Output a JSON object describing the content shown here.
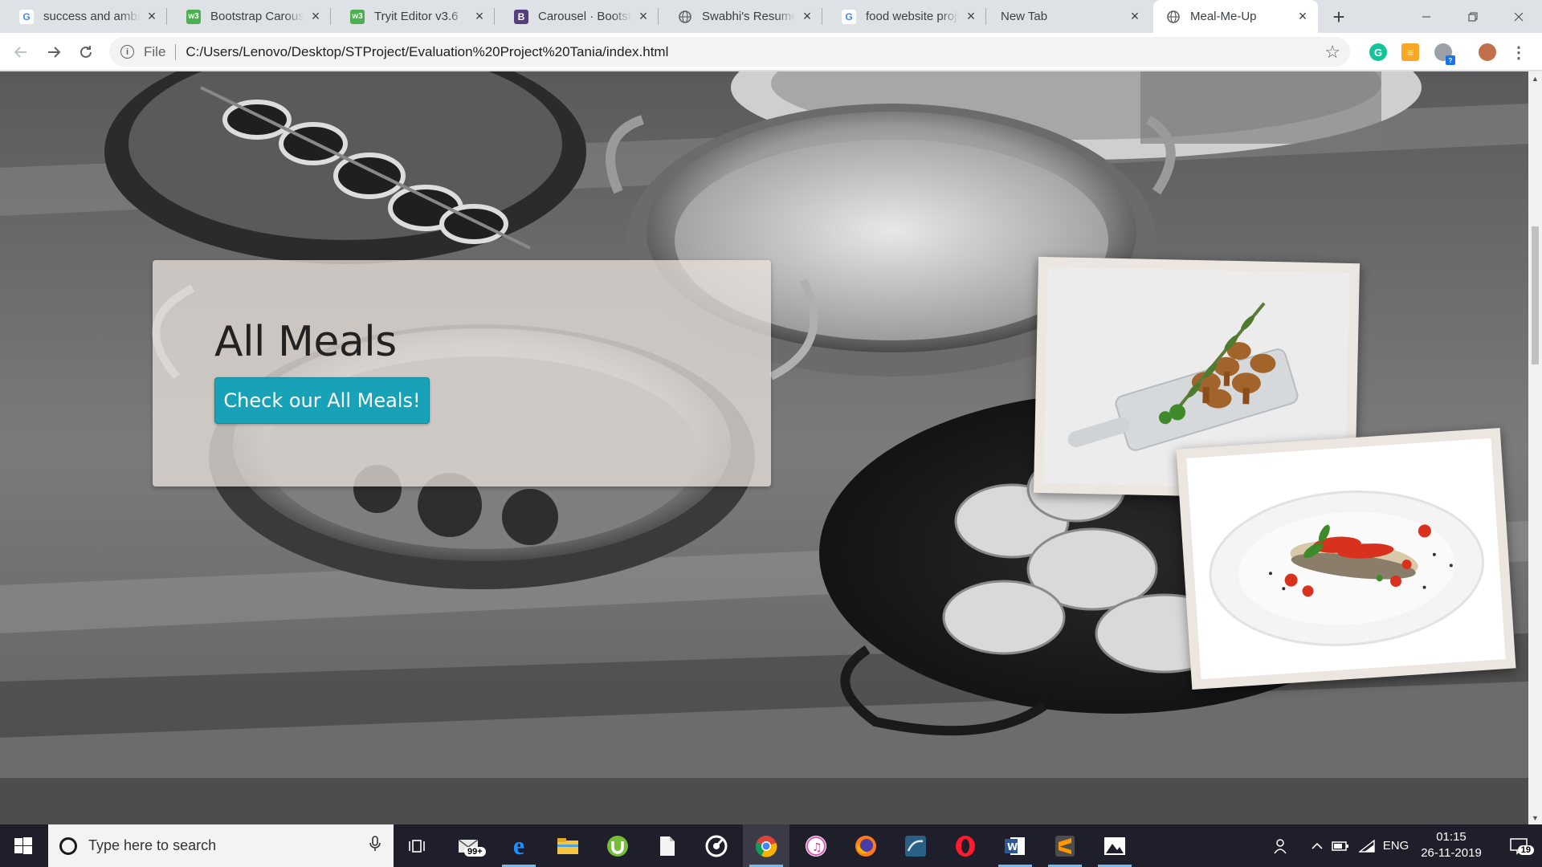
{
  "browser": {
    "tabs": [
      {
        "title": "success and ambiti",
        "favicon": "google-icon"
      },
      {
        "title": "Bootstrap Carousel",
        "favicon": "w3schools-icon"
      },
      {
        "title": "Tryit Editor v3.6",
        "favicon": "w3schools-icon"
      },
      {
        "title": "Carousel · Bootstrap",
        "favicon": "bootstrap-icon"
      },
      {
        "title": "Swabhi's Resume",
        "favicon": "globe-icon"
      },
      {
        "title": "food website proje",
        "favicon": "google-icon"
      },
      {
        "title": "New Tab",
        "favicon": ""
      },
      {
        "title": "Meal-Me-Up",
        "favicon": "globe-icon"
      }
    ],
    "active_tab_index": 7,
    "address": {
      "scheme_label": "File",
      "url": "C:/Users/Lenovo/Desktop/STProject/Evaluation%20Project%20Tania/index.html"
    }
  },
  "page": {
    "hero": {
      "title": "All Meals",
      "button_label": "Check our All Meals!"
    },
    "button_color": "#17a2b8"
  },
  "taskbar": {
    "search_placeholder": "Type here to search",
    "mail_badge": "99+",
    "language": "ENG",
    "time": "01:15",
    "date": "26-11-2019",
    "notification_count": "19"
  }
}
